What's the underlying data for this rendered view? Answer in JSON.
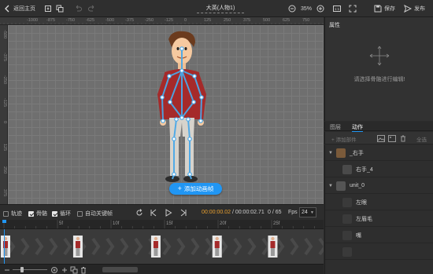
{
  "topbar": {
    "back_label": "返回主页",
    "title": "大英(人物1)",
    "zoom": "35%",
    "save_label": "保存",
    "publish_label": "发布"
  },
  "ruler_top": [
    "-1000",
    "-875",
    "-750",
    "-625",
    "-500",
    "-375",
    "-250",
    "-125",
    "0",
    "125",
    "250",
    "375",
    "500",
    "625",
    "750",
    "875",
    "1000"
  ],
  "ruler_left": [
    "-500",
    "-375",
    "-250",
    "-125",
    "0",
    "125",
    "250",
    "375"
  ],
  "canvas": {
    "add_frame_label": "添加动画帧"
  },
  "properties": {
    "title": "属性",
    "hint": "请选择骨骼进行编辑!"
  },
  "tabs": [
    {
      "label": "图层",
      "active": false
    },
    {
      "label": "动作",
      "active": true
    }
  ],
  "layer_toolbar": {
    "add_part_label": "+ 添加部件",
    "select_all_label": "全选"
  },
  "layers": [
    {
      "label": "_右手",
      "indent": 0,
      "expanded": true
    },
    {
      "label": "右手_4",
      "indent": 1
    },
    {
      "label": "unit_0",
      "indent": 0,
      "expanded": true
    },
    {
      "label": "左眼",
      "indent": 1
    },
    {
      "label": "左眉毛",
      "indent": 1
    },
    {
      "label": "嘴",
      "indent": 1
    },
    {
      "label": "",
      "indent": 1
    }
  ],
  "timeline": {
    "track_label": "轨迹",
    "bones_label": "骨骼",
    "loop_label": "循环",
    "auto_keyframe_label": "自动关键帧",
    "bones_checked": true,
    "loop_checked": true,
    "track_checked": false,
    "auto_keyframe_checked": false,
    "current_time": "00:00:00.02",
    "total_time": "00:00:02.71",
    "frame_current": "0",
    "frame_total": "65",
    "fps_label": "Fps",
    "fps_value": "24",
    "ruler_labels": [
      "5f",
      "10f",
      "15f",
      "20f",
      "25f"
    ],
    "keyframes": [
      0,
      13,
      27,
      38,
      48,
      58
    ]
  },
  "colors": {
    "accent": "#2196f3",
    "time": "#e8a030",
    "bone": "#4aa8e8"
  }
}
